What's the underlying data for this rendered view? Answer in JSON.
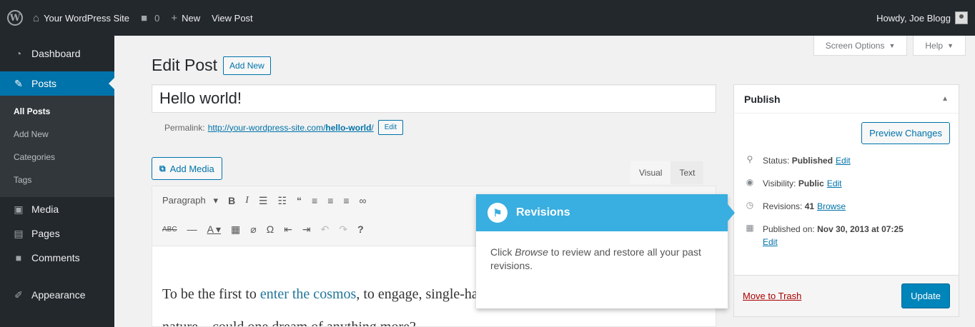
{
  "adminbar": {
    "site_name": "Your WordPress Site",
    "comments_count": "0",
    "new_label": "New",
    "view_post": "View Post",
    "howdy": "Howdy, Joe Blogg"
  },
  "sidebar": {
    "dashboard": "Dashboard",
    "posts": "Posts",
    "sub": [
      "All Posts",
      "Add New",
      "Categories",
      "Tags"
    ],
    "media": "Media",
    "pages": "Pages",
    "comments": "Comments",
    "appearance": "Appearance"
  },
  "screen_meta": {
    "screen_options": "Screen Options",
    "help": "Help"
  },
  "heading": {
    "title": "Edit Post",
    "add_new": "Add New"
  },
  "post": {
    "title": "Hello world!",
    "permalink_label": "Permalink:",
    "permalink_base": "http://your-wordpress-site.com/",
    "permalink_slug": "hello-world",
    "permalink_trail": "/",
    "edit": "Edit"
  },
  "editor": {
    "add_media": "Add Media",
    "tab_visual": "Visual",
    "tab_text": "Text",
    "format": "Paragraph",
    "content_before": "To be the first to ",
    "content_link": "enter the cosmos",
    "content_after": ", to engage, single-handed, in an unprecedented duel with nature—could one dream of anything more?"
  },
  "publish": {
    "title": "Publish",
    "preview": "Preview Changes",
    "status_label": "Status:",
    "status_value": "Published",
    "visibility_label": "Visibility:",
    "visibility_value": "Public",
    "revisions_label": "Revisions:",
    "revisions_count": "41",
    "browse": "Browse",
    "published_label": "Published on:",
    "published_value": "Nov 30, 2013 at 07:25",
    "edit": "Edit",
    "trash": "Move to Trash",
    "update": "Update"
  },
  "pointer": {
    "title": "Revisions",
    "body_before": "Click ",
    "body_em": "Browse",
    "body_after": " to review and restore all your past revisions."
  },
  "colors": {
    "admin_dark": "#23282d",
    "accent": "#0073aa",
    "pointer_blue": "#39aee0",
    "update_blue": "#0085ba",
    "trash_red": "#aa0000"
  }
}
